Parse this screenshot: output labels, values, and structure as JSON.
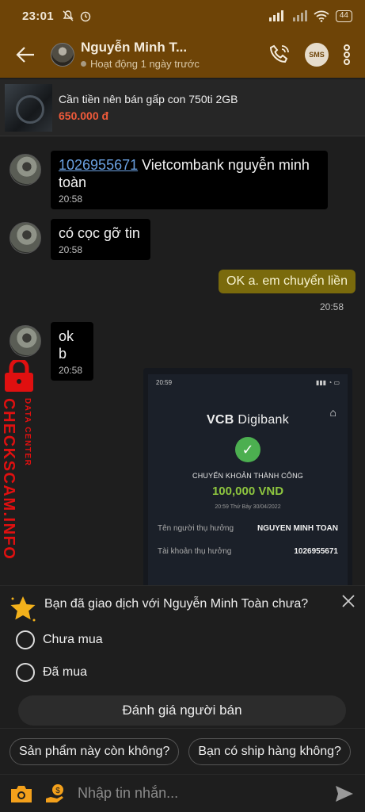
{
  "status_bar": {
    "time": "23:01",
    "battery": "44"
  },
  "header": {
    "name": "Nguyễn Minh T...",
    "status": "Hoạt động 1 ngày trước",
    "sms_label": "SMS"
  },
  "product": {
    "title": "Cần tiền nên bán gấp con 750ti 2GB",
    "price": "650.000 đ"
  },
  "messages": [
    {
      "link": "1026955671",
      "text": " Vietcombank nguyễn minh toàn",
      "time": "20:58"
    },
    {
      "text": "có cọc gỡ tin",
      "time": "20:58"
    },
    {
      "text": "OK a. em chuyển liền",
      "time": "20:58"
    },
    {
      "text": "ok b",
      "time": "20:58"
    }
  ],
  "transfer_screenshot": {
    "time": "20:59",
    "bank_bold": "VCB",
    "bank_rest": " Digibank",
    "status": "CHUYỂN KHOẢN THÀNH CÔNG",
    "amount": "100,000 VND",
    "datetime": "20:59 Thứ Bảy 30/04/2022",
    "rows": [
      {
        "k": "Tên người thụ hưởng",
        "v": "NGUYEN MINH TOAN"
      },
      {
        "k": "Tài khoản thụ hưởng",
        "v": "1026955671"
      }
    ]
  },
  "watermark": {
    "big": "CHECKSCAM.INFO",
    "small": "DATA CENTER"
  },
  "review": {
    "question": "Bạn đã giao dịch với Nguyễn Minh Toàn chưa?",
    "options": [
      "Chưa mua",
      "Đã mua"
    ],
    "button": "Đánh giá người bán"
  },
  "quick_replies": [
    "Sản phẩm này còn không?",
    "Bạn có ship hàng không?"
  ],
  "input": {
    "placeholder": "Nhập tin nhắn..."
  },
  "colors": {
    "header": "#6e4407",
    "outgoing": "#7a6a0c",
    "price": "#f05a3a",
    "watermark": "#e01010"
  }
}
